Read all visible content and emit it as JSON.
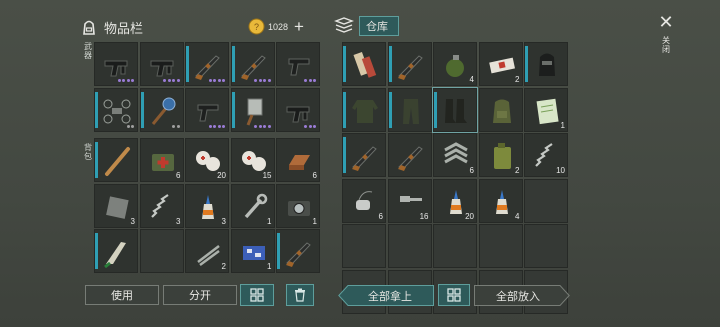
{
  "inventory": {
    "title": "物品栏",
    "coins": "1028",
    "add": "+"
  },
  "warehouse": {
    "title": "仓库"
  },
  "close": {
    "icon": "✕",
    "label": "关闭"
  },
  "side": {
    "weapon": "武器",
    "backpack": "背包"
  },
  "buttons": {
    "use": "使用",
    "split": "分开",
    "take_all": "全部拿上",
    "put_all": "全部放入"
  },
  "weapon_slots": [
    {
      "icon": "smg-icon",
      "dots": [
        "#9a7cd6",
        "#9a7cd6",
        "#9a7cd6",
        "#9a7cd6"
      ],
      "blue": false
    },
    {
      "icon": "smg-icon",
      "dots": [
        "#9a7cd6",
        "#9a7cd6",
        "#9a7cd6",
        "#9a7cd6"
      ],
      "blue": false
    },
    {
      "icon": "shotgun-icon",
      "dots": [
        "#9a7cd6",
        "#9a7cd6",
        "#9a7cd6",
        "#9a7cd6"
      ],
      "blue": true
    },
    {
      "icon": "shotgun-icon",
      "dots": [
        "#9a7cd6",
        "#9a7cd6",
        "#9a7cd6",
        "#9a7cd6"
      ],
      "blue": true
    },
    {
      "icon": "pistol-icon",
      "dots": [
        "#9a7cd6",
        "#9a7cd6",
        "#9a7cd6"
      ],
      "blue": false
    },
    {
      "icon": "drone-icon",
      "dots": [
        "#a0a0a0",
        "#a0a0a0"
      ],
      "blue": true
    },
    {
      "icon": "mace-icon",
      "dots": [
        "#a0a0a0",
        "#a0a0a0"
      ],
      "blue": true
    },
    {
      "icon": "pistol-icon",
      "dots": [
        "#9a7cd6",
        "#9a7cd6",
        "#9a7cd6",
        "#9a7cd6"
      ],
      "blue": false
    },
    {
      "icon": "cleaver-icon",
      "dots": [
        "#9a7cd6",
        "#9a7cd6",
        "#9a7cd6",
        "#9a7cd6"
      ],
      "blue": true
    },
    {
      "icon": "smg-icon",
      "dots": [
        "#9a7cd6",
        "#9a7cd6",
        "#9a7cd6"
      ],
      "blue": false
    }
  ],
  "backpack_slots": [
    {
      "icon": "bat-icon",
      "count": "",
      "blue": true
    },
    {
      "icon": "medkit-icon",
      "count": "6",
      "blue": false
    },
    {
      "icon": "bandage-icon",
      "count": "20",
      "blue": false
    },
    {
      "icon": "bandage-icon",
      "count": "15",
      "blue": false
    },
    {
      "icon": "copper-bar-icon",
      "count": "6",
      "blue": false
    },
    {
      "icon": "metal-plate-icon",
      "count": "3",
      "blue": false
    },
    {
      "icon": "spring-icon",
      "count": "3",
      "blue": false
    },
    {
      "icon": "glue-icon",
      "count": "3",
      "blue": false
    },
    {
      "icon": "wrench-icon",
      "count": "1",
      "blue": false
    },
    {
      "icon": "camera-icon",
      "count": "1",
      "blue": false
    },
    {
      "icon": "machete-icon",
      "count": "",
      "blue": true
    },
    {
      "icon": "",
      "count": "",
      "blue": false
    },
    {
      "icon": "pipes-icon",
      "count": "2",
      "blue": false
    },
    {
      "icon": "circuit-icon",
      "count": "1",
      "blue": false
    },
    {
      "icon": "shotgun-icon",
      "count": "",
      "blue": true
    }
  ],
  "warehouse_slots": [
    {
      "icon": "scroll-icon",
      "count": "",
      "blue": true
    },
    {
      "icon": "shotgun-icon",
      "count": "",
      "blue": true
    },
    {
      "icon": "grenade-icon",
      "count": "4",
      "blue": false
    },
    {
      "icon": "bandage-box-icon",
      "count": "2",
      "blue": false
    },
    {
      "icon": "balaclava-icon",
      "count": "",
      "blue": true
    },
    {
      "icon": "jacket-icon",
      "count": "",
      "blue": true
    },
    {
      "icon": "pants-icon",
      "count": "",
      "blue": true
    },
    {
      "icon": "boots-icon",
      "count": "",
      "blue": true,
      "selected": true
    },
    {
      "icon": "backpack-icon",
      "count": "",
      "blue": false
    },
    {
      "icon": "notebook-icon",
      "count": "1",
      "blue": false
    },
    {
      "icon": "shotgun-icon",
      "count": "",
      "blue": true
    },
    {
      "icon": "shotgun-icon",
      "count": "",
      "blue": false
    },
    {
      "icon": "rank-badge-icon",
      "count": "6",
      "blue": false
    },
    {
      "icon": "jerrycan-icon",
      "count": "2",
      "blue": false
    },
    {
      "icon": "spring-icon",
      "count": "10",
      "blue": false
    },
    {
      "icon": "dog-tag-icon",
      "count": "6",
      "blue": false
    },
    {
      "icon": "bolt-icon",
      "count": "16",
      "blue": false
    },
    {
      "icon": "glue-icon",
      "count": "20",
      "blue": false
    },
    {
      "icon": "glue-icon",
      "count": "4",
      "blue": false
    },
    {
      "icon": "",
      "count": "",
      "blue": false
    },
    {
      "icon": "",
      "count": "",
      "blue": false
    },
    {
      "icon": "",
      "count": "",
      "blue": false
    },
    {
      "icon": "",
      "count": "",
      "blue": false
    },
    {
      "icon": "",
      "count": "",
      "blue": false
    },
    {
      "icon": "",
      "count": "",
      "blue": false
    },
    {
      "icon": "",
      "count": "",
      "blue": false
    },
    {
      "icon": "",
      "count": "",
      "blue": false
    },
    {
      "icon": "",
      "count": "",
      "blue": false
    },
    {
      "icon": "",
      "count": "",
      "blue": false
    },
    {
      "icon": "",
      "count": "",
      "blue": false
    }
  ]
}
